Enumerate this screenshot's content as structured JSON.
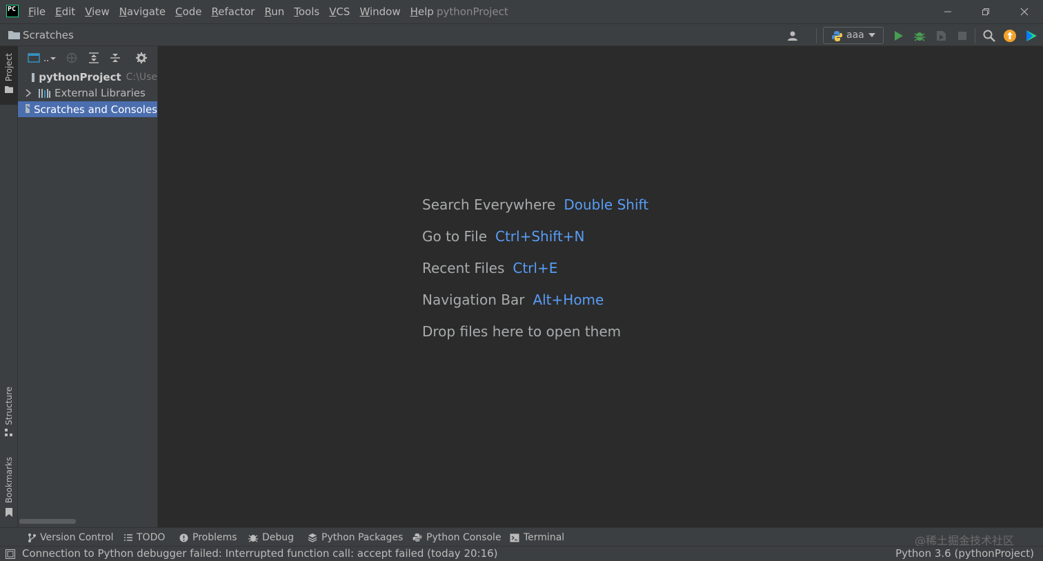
{
  "title_bar": {
    "menu": [
      "File",
      "Edit",
      "View",
      "Navigate",
      "Code",
      "Refactor",
      "Run",
      "Tools",
      "VCS",
      "Window",
      "Help"
    ],
    "project_title": "pythonProject",
    "app_icon_text": "PC"
  },
  "nav_bar": {
    "breadcrumb": "Scratches",
    "run_config": "aaa"
  },
  "left_stripe": {
    "project": "Project",
    "structure": "Structure",
    "bookmarks": "Bookmarks"
  },
  "project_tree": {
    "items": [
      {
        "label": "pythonProject",
        "path": "C:\\Use",
        "icon": "folder-icon"
      },
      {
        "label": "External Libraries",
        "icon": "library-icon"
      },
      {
        "label": "Scratches and Consoles",
        "icon": "scratches-icon",
        "selected": true
      }
    ]
  },
  "editor_hints": [
    {
      "action": "Search Everywhere",
      "shortcut": "Double Shift"
    },
    {
      "action": "Go to File",
      "shortcut": "Ctrl+Shift+N"
    },
    {
      "action": "Recent Files",
      "shortcut": "Ctrl+E"
    },
    {
      "action": "Navigation Bar",
      "shortcut": "Alt+Home"
    },
    {
      "action": "Drop files here to open them",
      "shortcut": ""
    }
  ],
  "tool_windows": [
    {
      "label": "Version Control",
      "icon": "branch-icon"
    },
    {
      "label": "TODO",
      "icon": "list-icon"
    },
    {
      "label": "Problems",
      "icon": "warning-icon"
    },
    {
      "label": "Debug",
      "icon": "bug-icon"
    },
    {
      "label": "Python Packages",
      "icon": "layers-icon"
    },
    {
      "label": "Python Console",
      "icon": "python-icon"
    },
    {
      "label": "Terminal",
      "icon": "terminal-icon"
    }
  ],
  "watermark": "@稀土掘金技术社区",
  "status_bar": {
    "message": "Connection to Python debugger failed: Interrupted function call: accept failed (today 20:16)",
    "interpreter": "Python 3.6 (pythonProject)"
  },
  "colors": {
    "accent": "#589df6",
    "selection": "#4b6eaf",
    "run_green": "#499c54",
    "update_orange": "#f4a32a"
  }
}
